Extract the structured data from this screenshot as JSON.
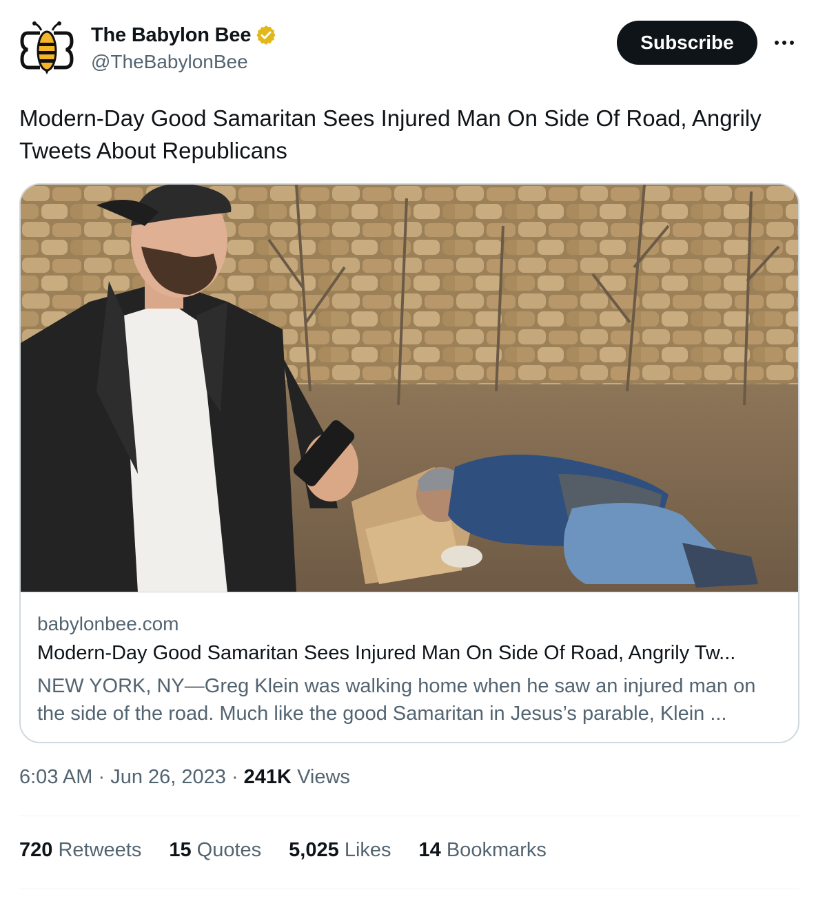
{
  "account": {
    "display_name": "The Babylon Bee",
    "handle": "@TheBabylonBee",
    "verified_color": "#e2b719"
  },
  "actions": {
    "subscribe_label": "Subscribe",
    "more_icon": "more-horizontal-icon"
  },
  "tweet": {
    "text": "Modern-Day Good Samaritan Sees Injured Man On Side Of Road, Angrily Tweets About Republicans"
  },
  "link_card": {
    "domain": "babylonbee.com",
    "title": "Modern-Day Good Samaritan Sees Injured Man On Side Of Road, Angrily Tw...",
    "description": "NEW YORK, NY—Greg Klein was walking home when he saw an injured man on the side of the road. Much like the good Samaritan in Jesus’s parable, Klein ..."
  },
  "meta": {
    "time": "6:03 AM",
    "date": "Jun 26, 2023",
    "views_count": "241K",
    "views_label": "Views"
  },
  "stats": [
    {
      "count": "720",
      "label": "Retweets"
    },
    {
      "count": "15",
      "label": "Quotes"
    },
    {
      "count": "5,025",
      "label": "Likes"
    },
    {
      "count": "14",
      "label": "Bookmarks"
    }
  ],
  "colors": {
    "text_primary": "#0f1419",
    "text_secondary": "#536471",
    "border": "#cfd9de",
    "logo_yellow": "#f5b42a"
  }
}
